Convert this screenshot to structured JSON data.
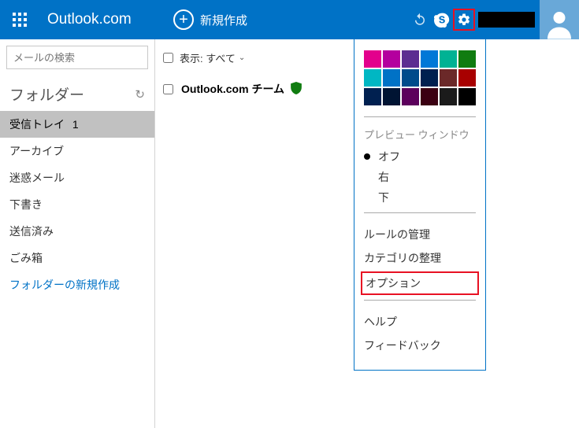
{
  "header": {
    "brand": "Outlook.com",
    "compose": "新規作成"
  },
  "search": {
    "placeholder": "メールの検索"
  },
  "folders": {
    "heading": "フォルダー",
    "items": [
      {
        "label": "受信トレイ",
        "count": "1",
        "active": true
      },
      {
        "label": "アーカイブ"
      },
      {
        "label": "迷惑メール"
      },
      {
        "label": "下書き"
      },
      {
        "label": "送信済み"
      },
      {
        "label": "ごみ箱"
      }
    ],
    "new_folder": "フォルダーの新規作成"
  },
  "content": {
    "view_label": "表示:",
    "view_value": "すべて",
    "message": {
      "sender": "Outlook.com チーム"
    }
  },
  "settings": {
    "colors_row1": [
      "#e3008c",
      "#b4009e",
      "#5c2d91",
      "#0078d7",
      "#00b294",
      "#107c10"
    ],
    "colors_row2": [
      "#00b7c3",
      "#0072c6",
      "#004b8b",
      "#002050",
      "#6b2929",
      "#a80000"
    ],
    "colors_row3": [
      "#002050",
      "#001433",
      "#5c005c",
      "#3b0012",
      "#1b1b1b",
      "#000000"
    ],
    "preview_label": "プレビュー ウィンドウ",
    "preview_options": [
      "オフ",
      "右",
      "下"
    ],
    "preview_selected": 0,
    "links1": [
      "ルールの管理",
      "カテゴリの整理",
      "オプション"
    ],
    "link_highlight": 2,
    "links2": [
      "ヘルプ",
      "フィードバック"
    ]
  }
}
